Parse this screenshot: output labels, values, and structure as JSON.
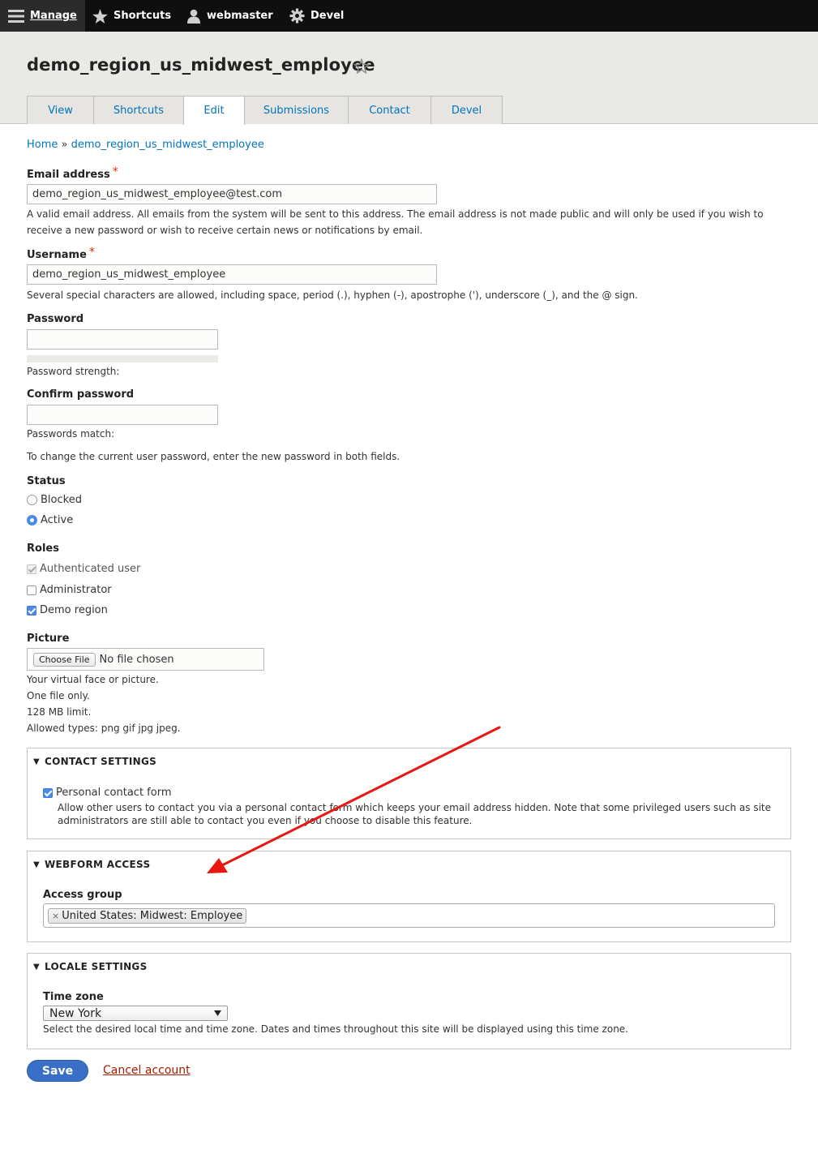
{
  "toolbar": {
    "manage": "Manage",
    "shortcuts": "Shortcuts",
    "user": "webmaster",
    "devel": "Devel"
  },
  "page": {
    "title": "demo_region_us_midwest_employee"
  },
  "tabs": [
    {
      "label": "View"
    },
    {
      "label": "Shortcuts"
    },
    {
      "label": "Edit",
      "active": true
    },
    {
      "label": "Submissions"
    },
    {
      "label": "Contact"
    },
    {
      "label": "Devel"
    }
  ],
  "breadcrumb": {
    "home": "Home",
    "separator": "»",
    "current": "demo_region_us_midwest_employee"
  },
  "email": {
    "label": "Email address",
    "required_mark": "*",
    "value": "demo_region_us_midwest_employee@test.com",
    "description_line1": "A valid email address. All emails from the system will be sent to this address. The email address is not made public and will only be used if you wish to",
    "description_line2": "receive a new password or wish to receive certain news or notifications by email."
  },
  "username": {
    "label": "Username",
    "required_mark": "*",
    "value": "demo_region_us_midwest_employee",
    "description": "Several special characters are allowed, including space, period (.), hyphen (-), apostrophe ('), underscore (_), and the @ sign."
  },
  "password": {
    "label": "Password",
    "value": "",
    "strength_label": "Password strength:"
  },
  "confirm_password": {
    "label": "Confirm password",
    "value": "",
    "match_label": "Passwords match:",
    "description": "To change the current user password, enter the new password in both fields."
  },
  "status": {
    "label": "Status",
    "options": [
      {
        "label": "Blocked",
        "selected": false
      },
      {
        "label": "Active",
        "selected": true
      }
    ]
  },
  "roles": {
    "label": "Roles",
    "options": [
      {
        "label": "Authenticated user",
        "checked": true,
        "disabled": true
      },
      {
        "label": "Administrator",
        "checked": false
      },
      {
        "label": "Demo region",
        "checked": true
      }
    ]
  },
  "picture": {
    "label": "Picture",
    "button": "Choose File",
    "no_file": "No file chosen",
    "help": [
      "Your virtual face or picture.",
      "One file only.",
      "128 MB limit.",
      "Allowed types: png gif jpg jpeg."
    ]
  },
  "contact_settings": {
    "legend": "CONTACT SETTINGS",
    "checkbox_label": "Personal contact form",
    "checked": true,
    "description_line1": "Allow other users to contact you via a personal contact form which keeps your email address hidden. Note that some privileged users such as site",
    "description_line2": "administrators are still able to contact you even if you choose to disable this feature."
  },
  "webform_access": {
    "legend": "WEBFORM ACCESS",
    "field_label": "Access group",
    "chip_remove": "×",
    "chip": "United States: Midwest: Employee"
  },
  "locale_settings": {
    "legend": "LOCALE SETTINGS",
    "field_label": "Time zone",
    "selected": "New York",
    "description": "Select the desired local time and time zone. Dates and times throughout this site will be displayed using this time zone."
  },
  "actions": {
    "save": "Save",
    "cancel": "Cancel account"
  },
  "colors": {
    "toolbar_bg": "#0f0f0f",
    "link": "#0074bd",
    "required": "#e62600",
    "primary_button": "#3a6fc7",
    "cancel_link": "#a51b00",
    "annotation_arrow": "#e8170f"
  }
}
